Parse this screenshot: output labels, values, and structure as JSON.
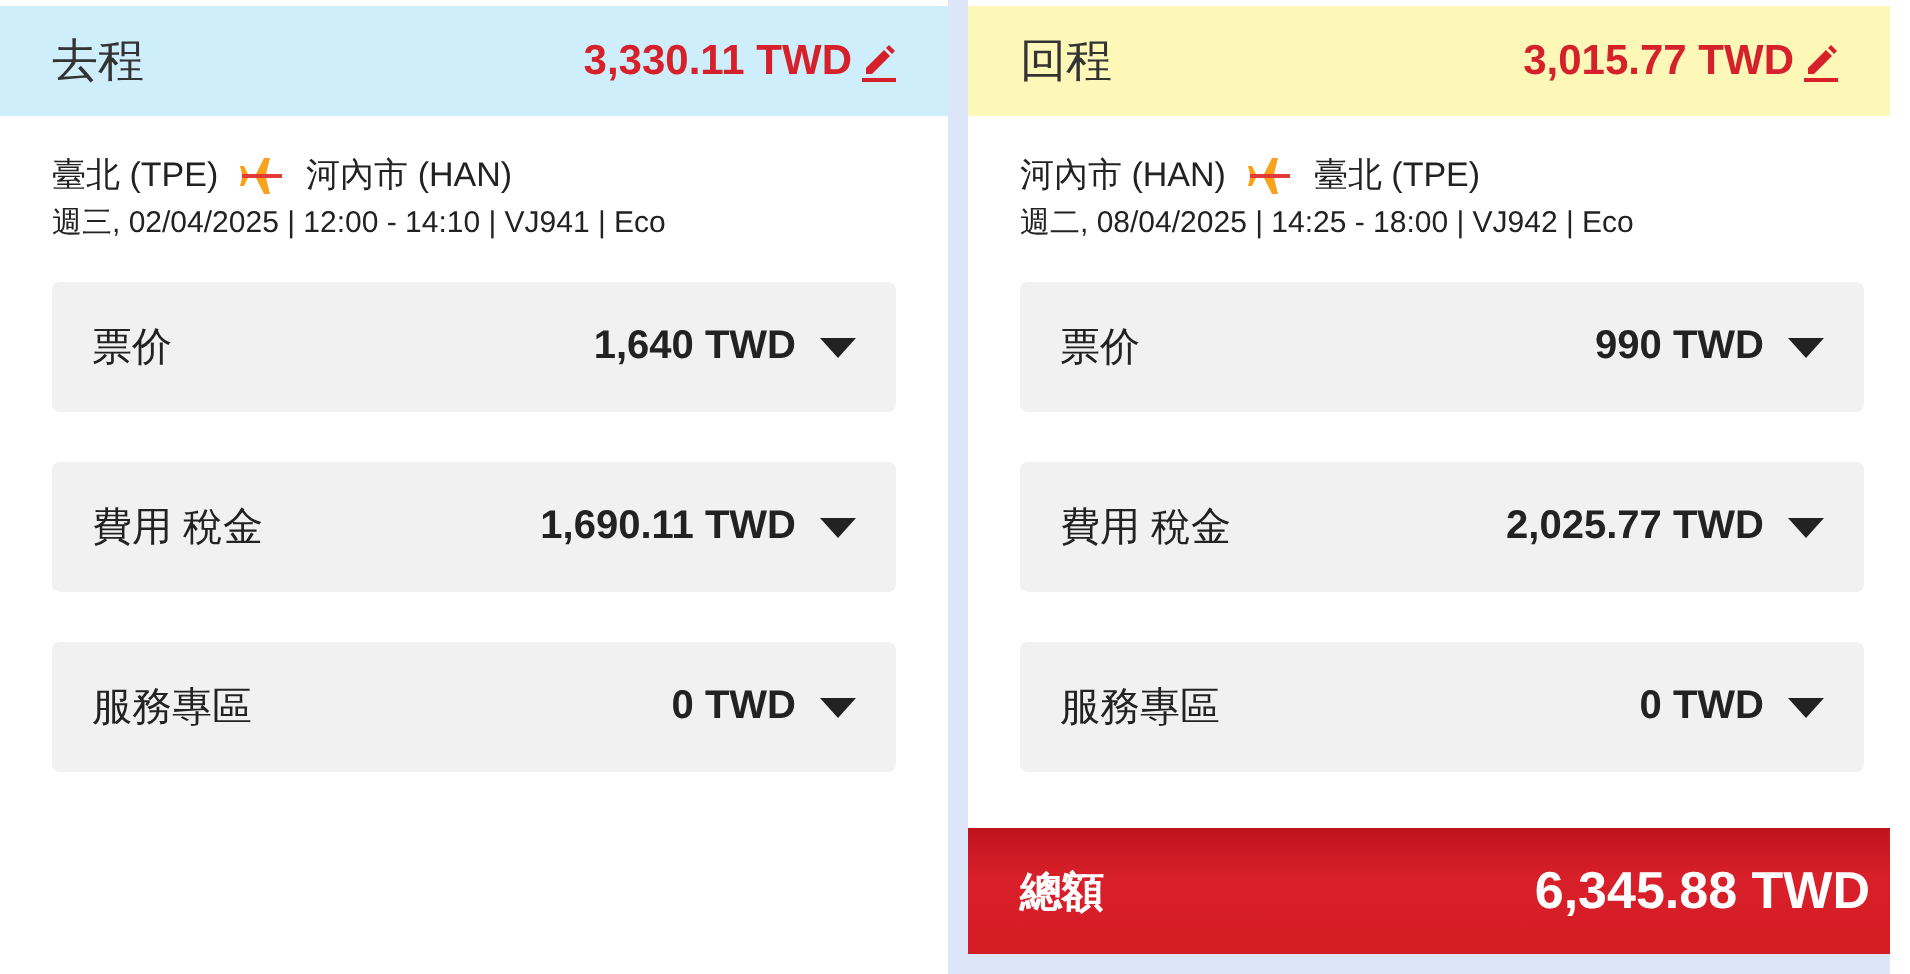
{
  "legs": [
    {
      "title": "去程",
      "color": "#cdeefa",
      "amount": "3,330.11 TWD",
      "from": "臺北 (TPE)",
      "to": "河內市 (HAN)",
      "details": "週三, 02/04/2025 | 12:00 - 14:10 | VJ941 | Eco",
      "items": [
        {
          "label": "票价",
          "amount": "1,640 TWD"
        },
        {
          "label": "費用 稅金",
          "amount": "1,690.11 TWD"
        },
        {
          "label": "服務專區",
          "amount": "0 TWD"
        }
      ]
    },
    {
      "title": "回程",
      "color": "#fdf7b8",
      "amount": "3,015.77 TWD",
      "from": "河內市 (HAN)",
      "to": "臺北 (TPE)",
      "details": "週二, 08/04/2025 | 14:25 - 18:00 | VJ942 | Eco",
      "items": [
        {
          "label": "票价",
          "amount": "990 TWD"
        },
        {
          "label": "費用 稅金",
          "amount": "2,025.77 TWD"
        },
        {
          "label": "服務專區",
          "amount": "0 TWD"
        }
      ]
    }
  ],
  "total": {
    "label": "總額",
    "amount": "6,345.88 TWD"
  }
}
